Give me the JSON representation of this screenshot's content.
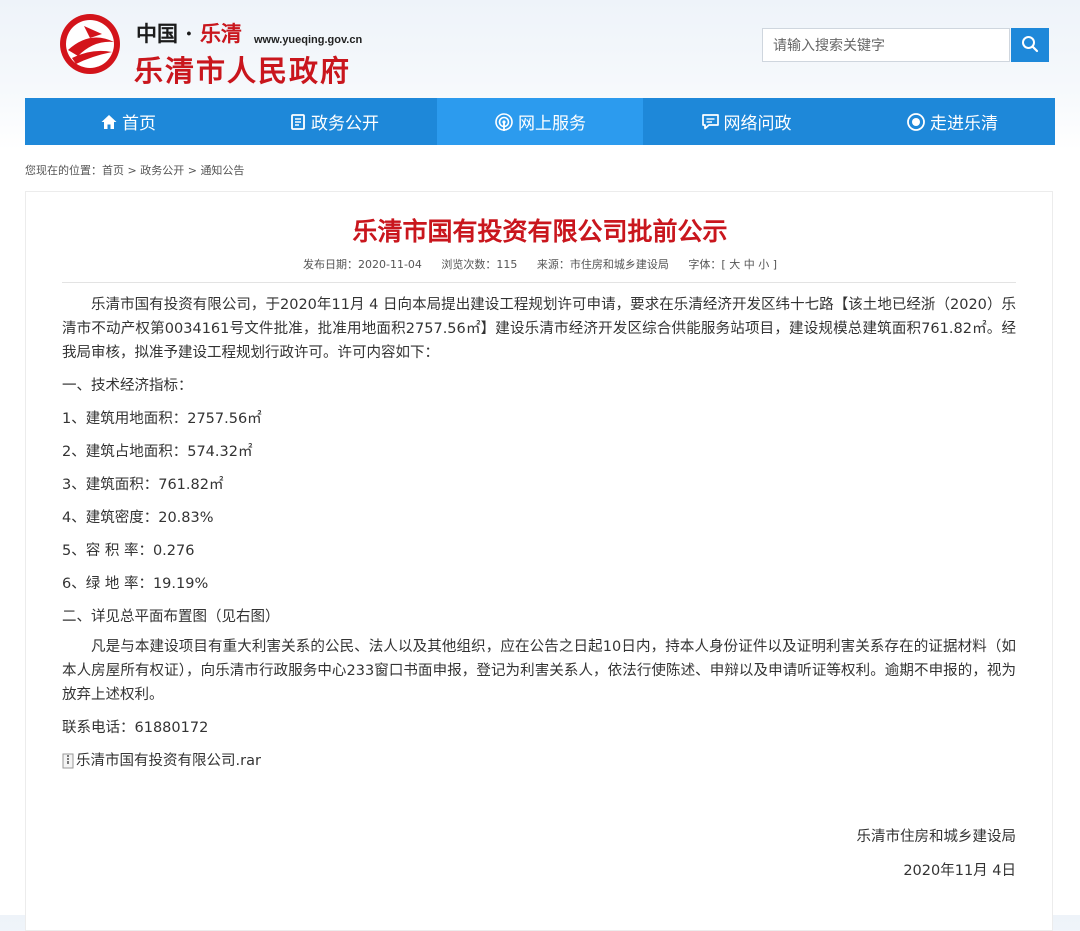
{
  "header": {
    "brand_top_a": "中国 · ",
    "brand_top_b": "乐清",
    "url": "www.yueqing.gov.cn",
    "site_name": "乐清市人民政府",
    "search_placeholder": "请输入搜索关键字",
    "search_icon": "search-icon"
  },
  "nav": {
    "items": [
      {
        "label": "首页",
        "icon": "home-icon"
      },
      {
        "label": "政务公开",
        "icon": "document-icon"
      },
      {
        "label": "网上服务",
        "icon": "signal-icon"
      },
      {
        "label": "网络问政",
        "icon": "chat-icon"
      },
      {
        "label": "走进乐清",
        "icon": "eye-icon"
      }
    ],
    "active_index": 2
  },
  "breadcrumb": {
    "prefix": "您现在的位置：",
    "items": [
      "首页",
      "政务公开",
      "通知公告"
    ],
    "sep": " > "
  },
  "article": {
    "title": "乐清市国有投资有限公司批前公示",
    "publish_date": "发布日期：2020-11-04",
    "views": "浏览次数：115",
    "source": "来源：市住房和城乡建设局",
    "font_size": "字体：[ 大 中 小 ]",
    "intro": "乐清市国有投资有限公司，于2020年11月 4 日向本局提出建设工程规划许可申请，要求在乐清经济开发区纬十七路【该土地已经浙（2020）乐清市不动产权第0034161号文件批准，批准用地面积2757.56㎡】建设乐清市经济开发区综合供能服务站项目，建设规模总建筑面积761.82㎡。经我局审核，拟准予建设工程规划行政许可。许可内容如下：",
    "section1": "一、技术经济指标：",
    "items": [
      "1、建筑用地面积：2757.56㎡",
      "2、建筑占地面积：574.32㎡",
      "3、建筑面积：761.82㎡",
      "4、建筑密度：20.83%",
      "5、容 积 率：0.276",
      "6、绿 地 率：19.19%"
    ],
    "section2": "二、详见总平面布置图（见右图）",
    "notice": "凡是与本建设项目有重大利害关系的公民、法人以及其他组织，应在公告之日起10日内，持本人身份证件以及证明利害关系存在的证据材料（如本人房屋所有权证），向乐清市行政服务中心233窗口书面申报，登记为利害关系人，依法行使陈述、申辩以及申请听证等权利。逾期不申报的，视为放弃上述权利。",
    "phone": "联系电话：61880172",
    "attachment": "乐清市国有投资有限公司.rar",
    "sign_org": "乐清市住房和城乡建设局",
    "sign_date": "2020年11月 4日"
  },
  "colors": {
    "primary_blue": "#1e88d9",
    "active_blue": "#2c9bee",
    "title_red": "#c9161d"
  }
}
